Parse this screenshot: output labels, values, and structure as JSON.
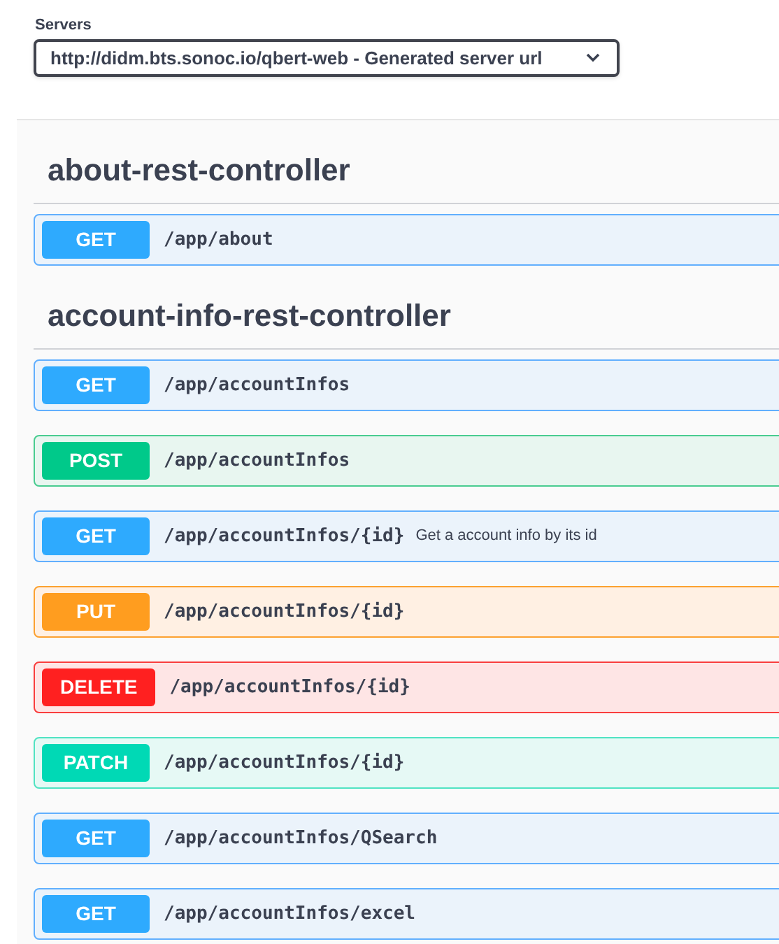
{
  "servers": {
    "label": "Servers",
    "value": "http://didm.bts.sonoc.io/qbert-web - Generated server url"
  },
  "sections": [
    {
      "title": "about-rest-controller",
      "operations": [
        {
          "method": "GET",
          "kind": "get",
          "path": "/app/about"
        }
      ]
    },
    {
      "title": "account-info-rest-controller",
      "operations": [
        {
          "method": "GET",
          "kind": "get",
          "path": "/app/accountInfos"
        },
        {
          "method": "POST",
          "kind": "post",
          "path": "/app/accountInfos"
        },
        {
          "method": "GET",
          "kind": "get",
          "path": "/app/accountInfos/{id}",
          "summary": "Get a account info by its id"
        },
        {
          "method": "PUT",
          "kind": "put",
          "path": "/app/accountInfos/{id}"
        },
        {
          "method": "DELETE",
          "kind": "delete",
          "path": "/app/accountInfos/{id}"
        },
        {
          "method": "PATCH",
          "kind": "patch",
          "path": "/app/accountInfos/{id}"
        },
        {
          "method": "GET",
          "kind": "get",
          "path": "/app/accountInfos/QSearch"
        },
        {
          "method": "GET",
          "kind": "get",
          "path": "/app/accountInfos/excel"
        }
      ]
    }
  ]
}
